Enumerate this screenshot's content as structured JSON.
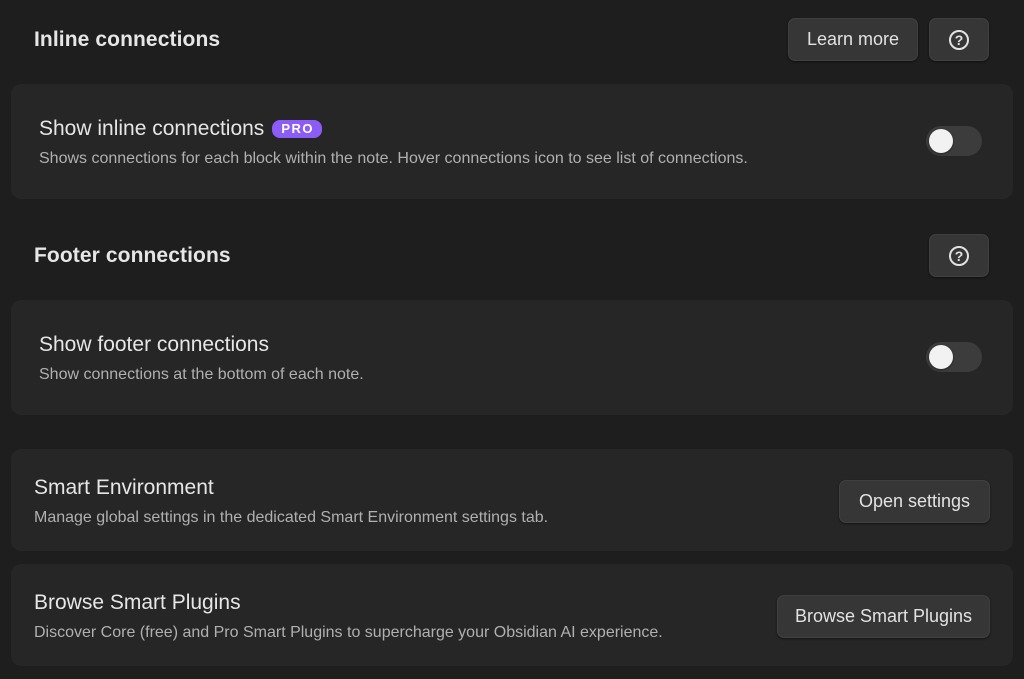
{
  "inline": {
    "heading": "Inline connections",
    "learn_more_label": "Learn more",
    "help_icon": "question-circle-icon",
    "setting": {
      "name": "Show inline connections",
      "badge": "PRO",
      "description": "Shows connections for each block within the note. Hover connections icon to see list of connections.",
      "enabled": false
    }
  },
  "footer": {
    "heading": "Footer connections",
    "help_icon": "question-circle-icon",
    "setting": {
      "name": "Show footer connections",
      "description": "Show connections at the bottom of each note.",
      "enabled": false
    }
  },
  "smart_environment": {
    "name": "Smart Environment",
    "description": "Manage global settings in the dedicated Smart Environment settings tab.",
    "button_label": "Open settings"
  },
  "browse_plugins": {
    "name": "Browse Smart Plugins",
    "description": "Discover Core (free) and Pro Smart Plugins to supercharge your Obsidian AI experience.",
    "button_label": "Browse Smart Plugins"
  },
  "colors": {
    "background": "#1e1e1e",
    "card": "#262626",
    "pro_badge": "#8b5cf6",
    "toggle_off": "#3c3c3c"
  }
}
